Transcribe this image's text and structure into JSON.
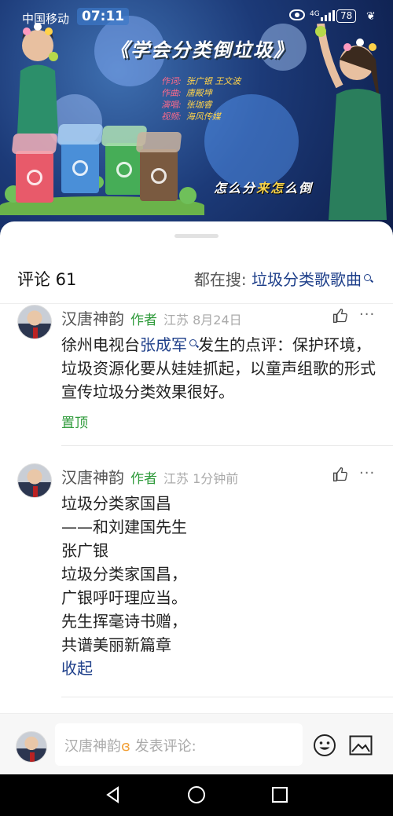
{
  "status_bar": {
    "carrier": "中国移动",
    "time": "07:11",
    "network": "4G",
    "battery": "78"
  },
  "video": {
    "title": "《学会分类倒垃圾》",
    "credits": [
      {
        "role": "作词:",
        "name": "张广银 王文波"
      },
      {
        "role": "作曲:",
        "name": "唐殿坤"
      },
      {
        "role": "演唱:",
        "name": "张珈睿"
      },
      {
        "role": "视频:",
        "name": "海风传媒"
      }
    ],
    "subtitle_pre": "怎么分",
    "subtitle_hl": "来怎",
    "subtitle_post": "么倒"
  },
  "comments_panel": {
    "count_label": "评论 61",
    "search_prefix": "都在搜: ",
    "search_keyword": "垃圾分类歌歌曲"
  },
  "comments": [
    {
      "author": "汉唐神韵",
      "tag": "作者",
      "location_time": "江苏 8月24日",
      "text_pre": "徐州电视台",
      "mention": "张成军",
      "text_post": "发生的点评：保护环境，垃圾资源化要从娃娃抓起，以童声组歌的形式宣传垃圾分类效果很好。",
      "pin_label": "置顶"
    },
    {
      "author": "汉唐神韵",
      "tag": "作者",
      "location_time": "江苏 1分钟前",
      "lines": [
        "垃圾分类家国昌",
        "——和刘建国先生",
        "张广银",
        "垃圾分类家国昌，",
        "广银呼吁理应当。",
        "先生挥毫诗书赠，",
        "共谱美丽新篇章"
      ],
      "collapse_label": "收起"
    }
  ],
  "input_bar": {
    "user": "汉唐神韵",
    "placeholder": " 发表评论:"
  },
  "colors": {
    "accent_blue": "#1e3f8a",
    "author_green": "#2e9a3a"
  }
}
